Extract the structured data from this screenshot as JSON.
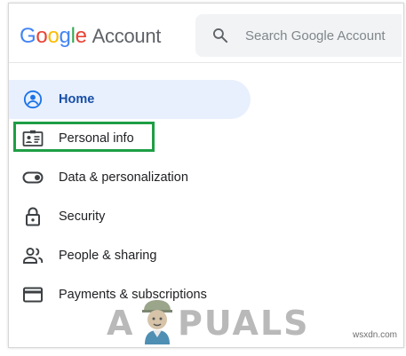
{
  "header": {
    "logo_letters": [
      "G",
      "o",
      "o",
      "g",
      "l",
      "e"
    ],
    "product": "Account",
    "search": {
      "placeholder": "Search Google Account",
      "icon": "search-icon"
    }
  },
  "nav": {
    "items": [
      {
        "label": "Home",
        "icon": "account-circle-icon",
        "active": true
      },
      {
        "label": "Personal info",
        "icon": "id-card-icon",
        "highlighted": true
      },
      {
        "label": "Data & personalization",
        "icon": "toggle-icon"
      },
      {
        "label": "Security",
        "icon": "lock-icon"
      },
      {
        "label": "People & sharing",
        "icon": "people-icon"
      },
      {
        "label": "Payments & subscriptions",
        "icon": "credit-card-icon"
      }
    ]
  },
  "watermark": {
    "left": "A",
    "right": "PUALS",
    "site": "wsxdn.com"
  },
  "colors": {
    "active_bg": "#e8f0fe",
    "active_text": "#174ea6",
    "highlight_border": "#1e9e45",
    "icon": "#5f6368"
  }
}
